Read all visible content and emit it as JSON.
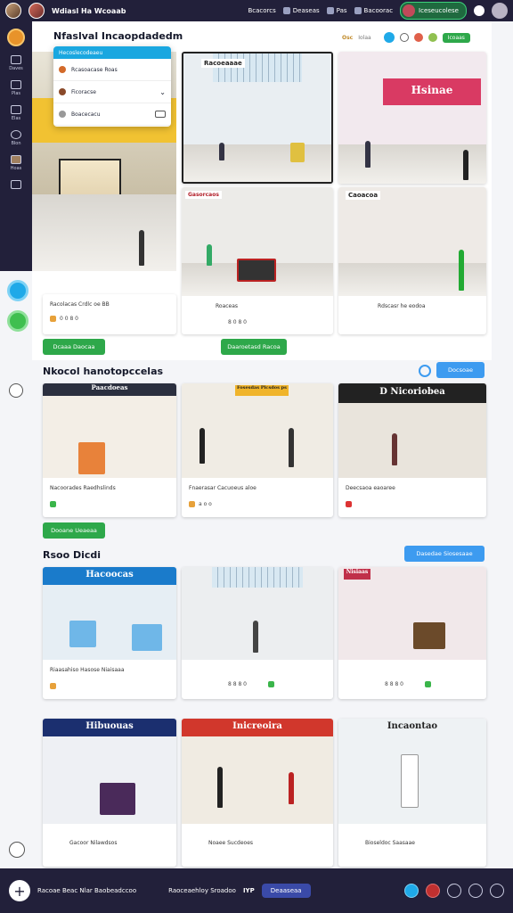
{
  "topbar": {
    "brand": "Wdiasl Ha Wcoaab",
    "nav": [
      "Bcacorcs",
      "Deaseas",
      "Pas",
      "Bacoorac"
    ],
    "pill_label": "Iceseucolese"
  },
  "sidebar": {
    "items": [
      {
        "label": "Daves",
        "icon": "mail-icon"
      },
      {
        "label": "Plas",
        "icon": "chat-icon"
      },
      {
        "label": "Elas",
        "icon": "message-icon"
      },
      {
        "label": "Blon",
        "icon": "clock-icon"
      },
      {
        "label": "Hoas",
        "icon": "image-icon"
      },
      {
        "label": "",
        "icon": "grid-icon"
      }
    ]
  },
  "main": {
    "title": "Nfaslval Incaopdadedm",
    "hero_sign": "Inodonrais",
    "dropdown": {
      "header": "Hecoslecodeaeu",
      "rows": [
        "Rcasoacase Roas",
        "Ficoracse",
        "Boacecacu"
      ]
    },
    "toolbar_tag": "Osc",
    "toolbar_tag2": "Iolaa",
    "toolbar_button": "Icoaas"
  },
  "sections": [
    {
      "title": "Nkocol hanotopccelas",
      "button": "Docsoae",
      "cards": [
        {
          "sign": "Paacdoeas",
          "cap": "Nacoorades Raedhslinds",
          "meta": "",
          "sign_color": "#2b2f3f"
        },
        {
          "sign": "Fosesdas Plcsdos ps",
          "cap": "Fnaerasar Cacuoeus aloe",
          "meta": "a o o",
          "sign_color": "#b2202a"
        },
        {
          "sign": "D Nicoriobea",
          "cap": "Deecsaoa eaoaree",
          "meta": "",
          "sign_color": "#222"
        }
      ]
    },
    {
      "title": "Rsoo Dicdi",
      "button": "Dasedae Siosesaae",
      "cards": [
        {
          "sign": "Hacoocas",
          "cap": "Riaasahiso Hasose Niaisaaa",
          "meta": "",
          "sign_color": "#1a7bcb"
        },
        {
          "sign": "",
          "cap": "",
          "meta": "8 8 8 0",
          "sign_color": "#222"
        },
        {
          "sign": "Nisiaas",
          "cap": "",
          "meta": "8 8 8 0",
          "sign_color": "#c0304a"
        }
      ]
    },
    {
      "title": "",
      "button": "",
      "cards": [
        {
          "sign": "Hibuouas",
          "cap": "Gacoor Nilawdsos",
          "meta": "",
          "sign_color": "#1b2f6f"
        },
        {
          "sign": "Inicreoira",
          "cap": "Noaee Sucdeoes",
          "meta": "",
          "sign_color": "#d1372c"
        },
        {
          "sign": "Incaontao",
          "cap": "Bioseldoc Saasaae",
          "meta": "",
          "sign_color": "#222"
        }
      ]
    }
  ],
  "row1_cards": [
    {
      "sign": "Racoeaaae",
      "cap": "Racolacas Crdlc oe BB",
      "meta": "0 0 8 0"
    },
    {
      "sign": "Gasorcaos",
      "cap": "Roaceas",
      "meta": "8 0 8 0"
    },
    {
      "sign": "Caoacoa",
      "cap": "Rdscasr he eodoa",
      "meta": ""
    },
    {
      "sign": "Hsinae",
      "cap": "",
      "meta": ""
    }
  ],
  "row1_buttons": [
    "Dcaaa Daocaa",
    "Daaroetasd Racoa"
  ],
  "section3_button": "Dooane Ueaeaa",
  "bottombar": {
    "left": "Racoae Beac Nlar Baobeadccoo",
    "mid": "Raoceaehloy Sroadoo",
    "tag": "IYP",
    "pill": "Deaaseaa"
  }
}
